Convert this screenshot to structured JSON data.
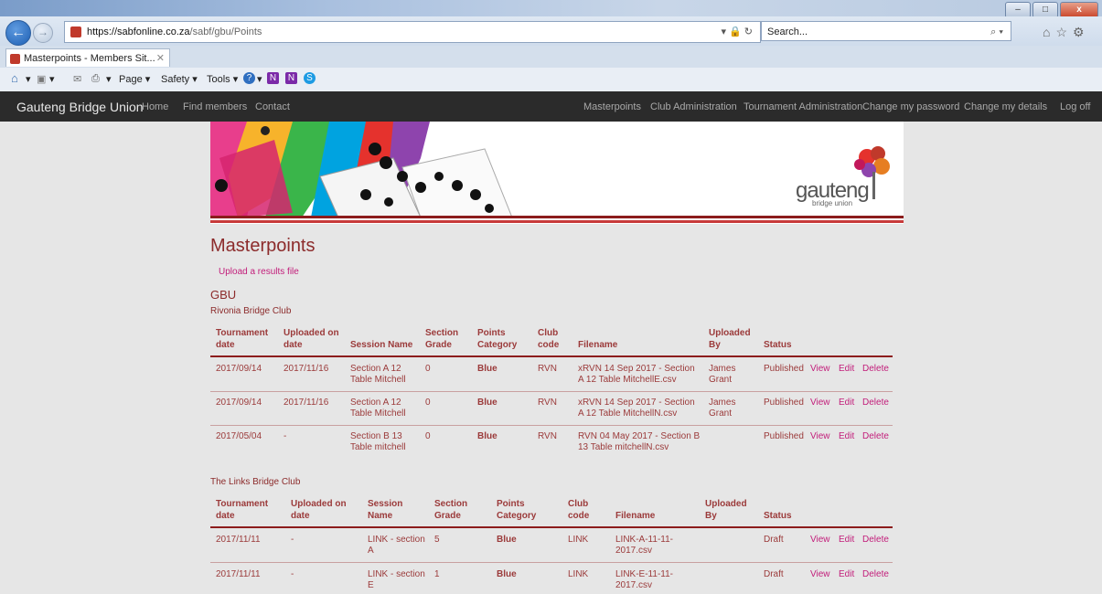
{
  "browser": {
    "url_host": "https://sabfonline.co.za",
    "url_path": "/sabf/gbu/Points",
    "url_icons": "▾ 🔒 ↻",
    "search_placeholder": "Search...",
    "search_icon": "⌕ ▾",
    "tab_title": "Masterpoints - Members Sit...",
    "tab_close": "✕",
    "right_icons": "⌂☆⚙",
    "win_min": "–",
    "win_max": "□",
    "win_close": "x",
    "back_glyph": "←",
    "fwd_glyph": "→",
    "cmd_page": "Page ▾",
    "cmd_safety": "Safety ▾",
    "cmd_tools": "Tools ▾",
    "cmd_dropdown": "▾",
    "home_glyph": "⌂",
    "feeds_glyph": "▣",
    "mail_glyph": "✉",
    "print_glyph": "⎙",
    "help_glyph": "?",
    "n_glyph": "N",
    "skype_glyph": "S"
  },
  "site": {
    "brand": "Gauteng Bridge Union",
    "nav_left": [
      "Home",
      "Find members",
      "Contact"
    ],
    "nav_right": [
      "Masterpoints",
      "Club Administration",
      "Tournament Administration",
      "Change my password",
      "Change my details",
      "Log off"
    ],
    "logo_text": "gauteng",
    "logo_sub": "bridge union"
  },
  "page": {
    "title": "Masterpoints",
    "upload_link": "Upload a results file",
    "org": "GBU"
  },
  "columns": [
    "Tournament date",
    "Uploaded on date",
    "Session Name",
    "Section Grade",
    "Points Category",
    "Club code",
    "Filename",
    "Uploaded By",
    "Status"
  ],
  "clubs": [
    {
      "name": "Rivonia Bridge Club",
      "rows": [
        {
          "tdate": "2017/09/14",
          "udate": "2017/11/16",
          "session": "Section A 12 Table Mitchell",
          "grade": "0",
          "category": "Blue",
          "code": "RVN",
          "filename": "xRVN 14 Sep 2017 - Section A 12 Table MitchellE.csv",
          "by": "James Grant",
          "status": "Published"
        },
        {
          "tdate": "2017/09/14",
          "udate": "2017/11/16",
          "session": "Section A 12 Table Mitchell",
          "grade": "0",
          "category": "Blue",
          "code": "RVN",
          "filename": "xRVN 14 Sep 2017 - Section A 12 Table MitchellN.csv",
          "by": "James Grant",
          "status": "Published"
        },
        {
          "tdate": "2017/05/04",
          "udate": "-",
          "session": "Section B 13 Table mitchell",
          "grade": "0",
          "category": "Blue",
          "code": "RVN",
          "filename": "RVN 04 May 2017 - Section B 13 Table mitchellN.csv",
          "by": "",
          "status": "Published"
        }
      ]
    },
    {
      "name": "The Links Bridge Club",
      "rows": [
        {
          "tdate": "2017/11/11",
          "udate": "-",
          "session": "LINK - section A",
          "grade": "5",
          "category": "Blue",
          "code": "LINK",
          "filename": "LINK-A-11-11-2017.csv",
          "by": "",
          "status": "Draft"
        },
        {
          "tdate": "2017/11/11",
          "udate": "-",
          "session": "LINK - section E",
          "grade": "1",
          "category": "Blue",
          "code": "LINK",
          "filename": "LINK-E-11-11-2017.csv",
          "by": "",
          "status": "Draft"
        }
      ]
    }
  ],
  "actions": [
    "View",
    "Edit",
    "Delete"
  ],
  "colors": {
    "accent": "#8c2b2b",
    "link": "#c21d7a",
    "navbar": "#2b2b2b"
  }
}
